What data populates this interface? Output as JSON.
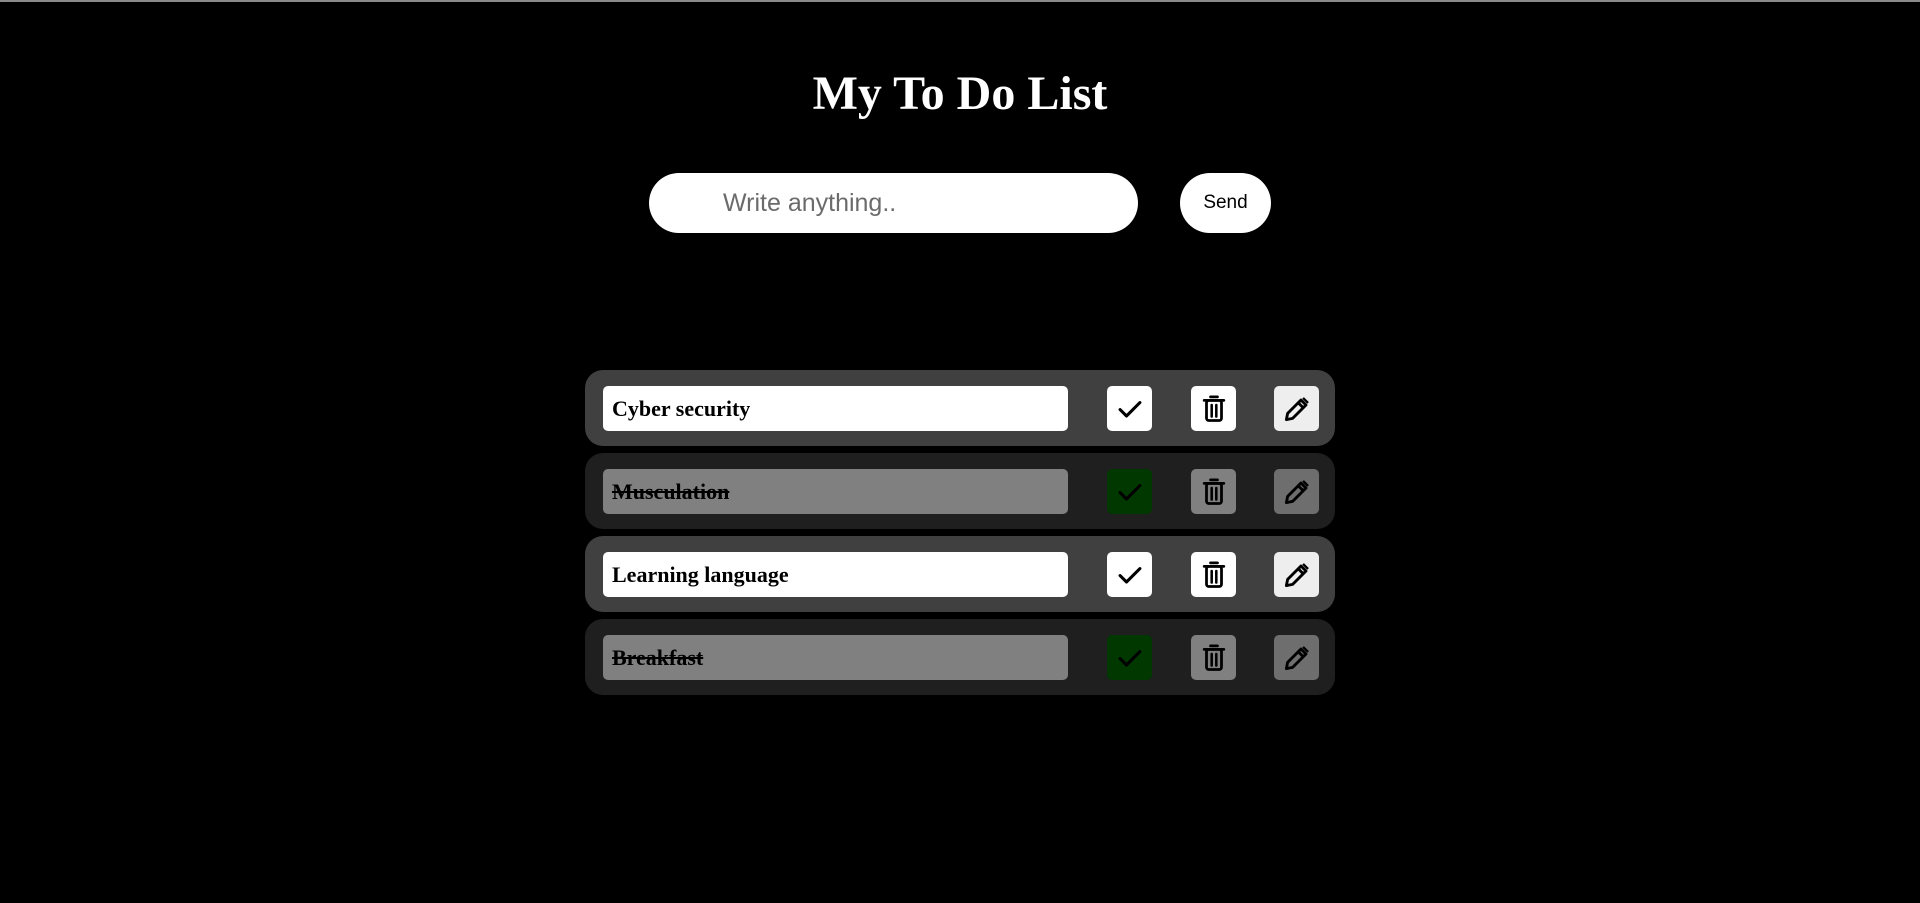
{
  "page": {
    "title": "My To Do List"
  },
  "composer": {
    "placeholder": "Write anything..",
    "value": "",
    "send_label": "Send"
  },
  "tasks": [
    {
      "text": "Cyber security",
      "completed": false
    },
    {
      "text": "Musculation",
      "completed": true
    },
    {
      "text": "Learning language",
      "completed": false
    },
    {
      "text": "Breakfast",
      "completed": true
    }
  ],
  "icons": {
    "complete": "check-icon",
    "delete": "trash-icon",
    "edit": "pencil-icon"
  },
  "colors": {
    "background": "#000000",
    "row_active": "#404040",
    "row_done": "#1f1f1f",
    "text_done_bg": "#808080",
    "check_done_bg": "#003800"
  }
}
